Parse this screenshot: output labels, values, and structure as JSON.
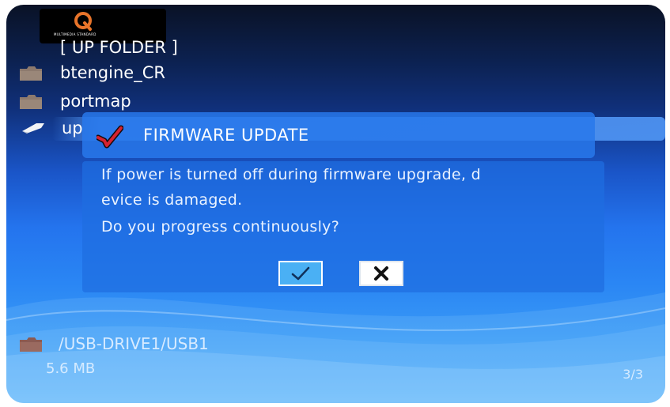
{
  "logo": {
    "text": "MULTIMEDIA STANDARD"
  },
  "file_list": {
    "items": [
      {
        "label": "[ UP FOLDER ]",
        "icon": "none"
      },
      {
        "label": "btengine_CR",
        "icon": "folder-icon"
      },
      {
        "label": "portmap",
        "icon": "folder-icon"
      },
      {
        "label": "up",
        "icon": "file-icon",
        "selected": true
      }
    ]
  },
  "dialog": {
    "title": "FIRMWARE UPDATE",
    "lines": [
      "If power is turned off during firmware upgrade, d",
      "evice is damaged.",
      "Do you progress continuously?"
    ],
    "ok_icon": "checkmark-icon",
    "cancel_icon": "x-icon"
  },
  "status": {
    "path": "/USB-DRIVE1/USB1",
    "size": "5.6 MB",
    "page": "3/3"
  },
  "colors": {
    "background_top": "#0a1226",
    "background_bottom": "#5ab2f8",
    "dialog": "#1e6ee1",
    "ok_button": "#4ab0f4",
    "check_red": "#d62230"
  }
}
